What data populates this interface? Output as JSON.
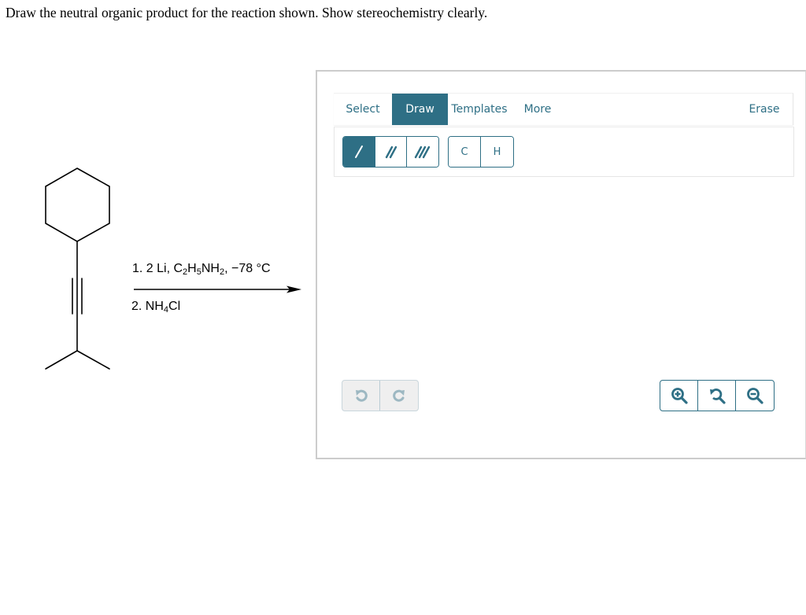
{
  "question": {
    "prompt": "Draw the neutral organic product for the reaction shown. Show stereochemistry clearly."
  },
  "reaction": {
    "reactant": {
      "name": "1-cyclohexyl-3-methylbut-1-yne",
      "structure_parts": [
        "cyclohexane-ring",
        "triple-bond",
        "isopropyl-group"
      ]
    },
    "arrow": "reaction-arrow",
    "reagents": {
      "step1": {
        "prefix": "1. 2 Li, C",
        "sub1": "2",
        "mid1": "H",
        "sub2": "5",
        "mid2": "NH",
        "sub3": "2",
        "suffix": ", −78 °C"
      },
      "step2": {
        "prefix": "2. NH",
        "sub1": "4",
        "suffix": "Cl"
      }
    }
  },
  "editor": {
    "tabs": [
      {
        "label": "Select",
        "active": false
      },
      {
        "label": "Draw",
        "active": true
      },
      {
        "label": "Templates",
        "active": false
      },
      {
        "label": "More",
        "active": false
      }
    ],
    "erase_label": "Erase",
    "bond_tools": [
      {
        "name": "single-bond",
        "icon": "single-bond-icon",
        "active": true
      },
      {
        "name": "double-bond",
        "icon": "double-bond-icon",
        "active": false
      },
      {
        "name": "triple-bond",
        "icon": "triple-bond-icon",
        "active": false
      }
    ],
    "atom_tools": [
      {
        "label": "C"
      },
      {
        "label": "H"
      }
    ],
    "history": [
      {
        "name": "undo",
        "icon": "undo-icon",
        "enabled": false
      },
      {
        "name": "redo",
        "icon": "redo-icon",
        "enabled": false
      }
    ],
    "zoom_controls": [
      {
        "name": "zoom-in",
        "icon": "zoom-in-icon"
      },
      {
        "name": "reset-zoom",
        "icon": "zoom-reset-icon"
      },
      {
        "name": "zoom-out",
        "icon": "zoom-out-icon"
      }
    ],
    "colors": {
      "accent": "#2e6f85",
      "disabled_icon": "#9db8c2",
      "disabled_bg": "#efefef",
      "panel_border": "#cccccc"
    }
  }
}
